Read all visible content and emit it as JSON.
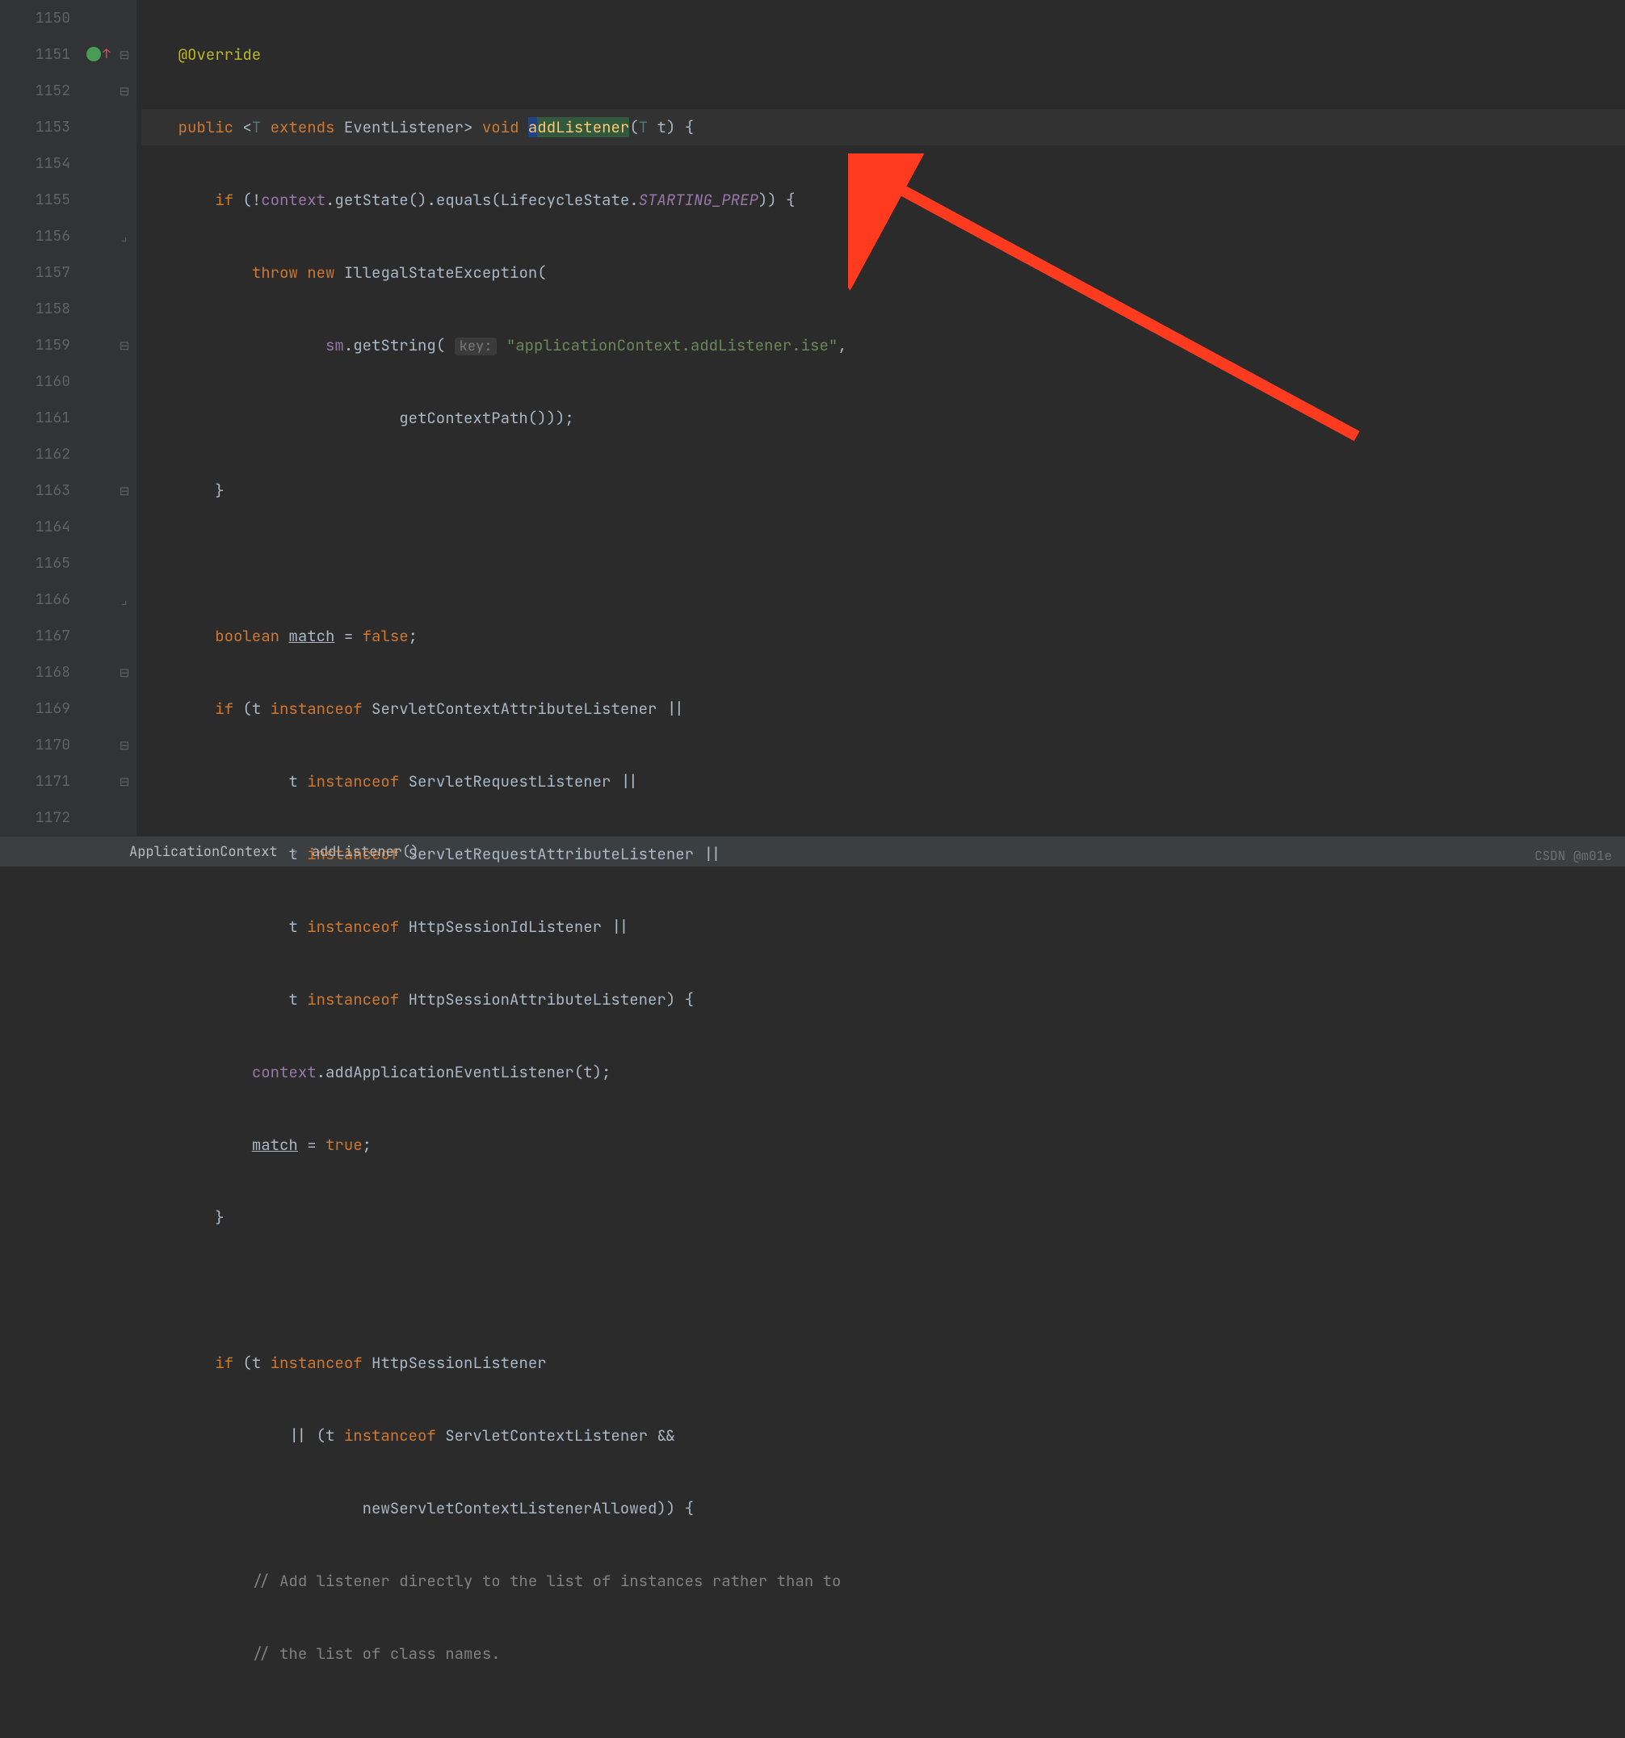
{
  "lines": [
    "1150",
    "1151",
    "1152",
    "1153",
    "1154",
    "1155",
    "1156",
    "1157",
    "1158",
    "1159",
    "1160",
    "1161",
    "1162",
    "1163",
    "1164",
    "1165",
    "1166",
    "1167",
    "1168",
    "1169",
    "1170",
    "1171",
    "1172"
  ],
  "tokens": {
    "override": "@Override",
    "public": "public",
    "extends": "extends",
    "void": "void",
    "T": "T",
    "EventListener": "EventListener",
    "addListener": "addListener",
    "addListener_a": "a",
    "addListener_rest": "ddListener",
    "t": "t",
    "if": "if",
    "context": "context",
    "getState": ".getState()",
    "equals": ".equals(",
    "LifecycleState": "LifecycleState.",
    "STARTING_PREP": "STARTING_PREP",
    "throw": "throw",
    "new": "new",
    "IllegalStateException": "IllegalStateException(",
    "sm": "sm",
    "getString": ".getString(",
    "keyhint": "key:",
    "stringLit": "\"applicationContext.addListener.ise\"",
    "getContextPath": "getContextPath()));",
    "boolean": "boolean",
    "match": "match",
    "false": "false",
    "true": "true",
    "instanceof": "instanceof",
    "ServletContextAttributeListener": "ServletContextAttributeListener ||",
    "ServletRequestListener": "ServletRequestListener ||",
    "ServletRequestAttributeListener": "ServletRequestAttributeListener ||",
    "HttpSessionIdListener": "HttpSessionIdListener ||",
    "HttpSessionAttributeListener": "HttpSessionAttributeListener) {",
    "addApplicationEventListener": ".addApplicationEventListener(t);",
    "HttpSessionListener": "HttpSessionListener",
    "ServletContextListener": "ServletContextListener &&",
    "newServletContextListenerAllowed": "newServletContextListenerAllowed)) {",
    "comment1": "// Add listener directly to the list of instances rather than to",
    "comment2": "// the list of class names."
  },
  "breadcrumbs": {
    "file": "ApplicationContext",
    "method": "addListener()"
  },
  "watermark": "CSDN @m01e"
}
